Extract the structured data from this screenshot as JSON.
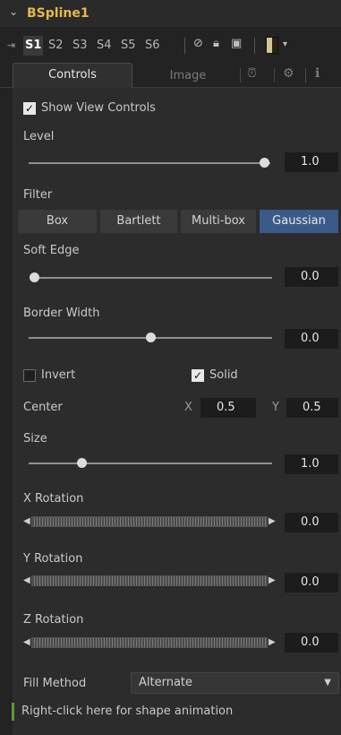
{
  "tool": {
    "title": "BSpline1"
  },
  "versions": [
    "S1",
    "S2",
    "S3",
    "S4",
    "S5",
    "S6"
  ],
  "tabs": {
    "controls": "Controls",
    "image": "Image"
  },
  "show_view_controls": {
    "label": "Show View Controls",
    "checked": true
  },
  "level": {
    "label": "Level",
    "value": "1.0",
    "fraction": 1.0
  },
  "filter": {
    "label": "Filter",
    "options": [
      "Box",
      "Bartlett",
      "Multi-box",
      "Gaussian"
    ],
    "selected": "Gaussian"
  },
  "soft_edge": {
    "label": "Soft Edge",
    "value": "0.0",
    "fraction": 0.0
  },
  "border_width": {
    "label": "Border Width",
    "value": "0.0",
    "fraction": 0.5
  },
  "invert": {
    "label": "Invert",
    "checked": false
  },
  "solid": {
    "label": "Solid",
    "checked": true
  },
  "center": {
    "label": "Center",
    "x_label": "X",
    "x_value": "0.5",
    "y_label": "Y",
    "y_value": "0.5"
  },
  "size": {
    "label": "Size",
    "value": "1.0",
    "fraction": 0.2
  },
  "x_rotation": {
    "label": "X Rotation",
    "value": "0.0"
  },
  "y_rotation": {
    "label": "Y Rotation",
    "value": "0.0"
  },
  "z_rotation": {
    "label": "Z Rotation",
    "value": "0.0"
  },
  "fill_method": {
    "label": "Fill Method",
    "value": "Alternate"
  },
  "footer": {
    "hint": "Right-click here for shape animation"
  },
  "colors": {
    "title": "#e6b94c",
    "selected_filter": "#3a5a8a",
    "footer_bar": "#5a9a3a"
  }
}
